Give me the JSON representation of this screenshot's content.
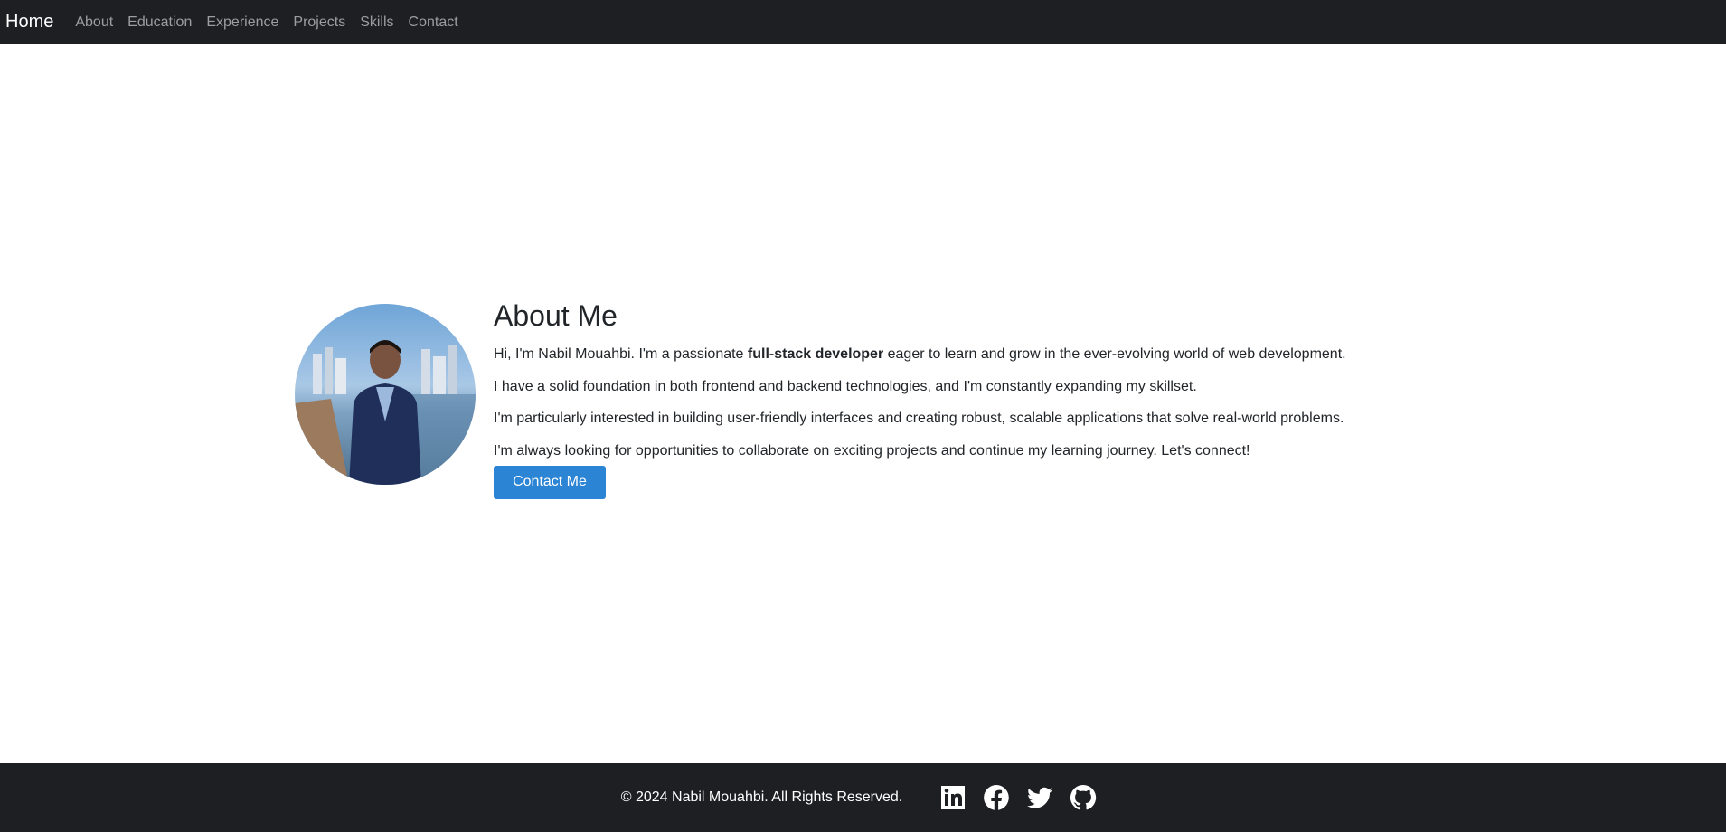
{
  "nav": {
    "brand": "Home",
    "items": [
      "About",
      "Education",
      "Experience",
      "Projects",
      "Skills",
      "Contact"
    ]
  },
  "about": {
    "title": "About Me",
    "p1_before": "Hi, I'm Nabil Mouahbi. I'm a passionate ",
    "p1_bold": "full-stack developer",
    "p1_after": " eager to learn and grow in the ever-evolving world of web development.",
    "p2": "I have a solid foundation in both frontend and backend technologies, and I'm constantly expanding my skillset.",
    "p3": "I'm particularly interested in building user-friendly interfaces and creating robust, scalable applications that solve real-world problems.",
    "p4": "I'm always looking for opportunities to collaborate on exciting projects and continue my learning journey. Let's connect!",
    "button": "Contact Me"
  },
  "footer": {
    "copyright": "© 2024 Nabil Mouahbi. All Rights Reserved.",
    "social_icons": [
      "linkedin-icon",
      "facebook-icon",
      "twitter-icon",
      "github-icon"
    ]
  },
  "colors": {
    "navbar_bg": "#1e1f23",
    "button_bg": "#2b84d4",
    "nav_link": "#9a9da2"
  }
}
